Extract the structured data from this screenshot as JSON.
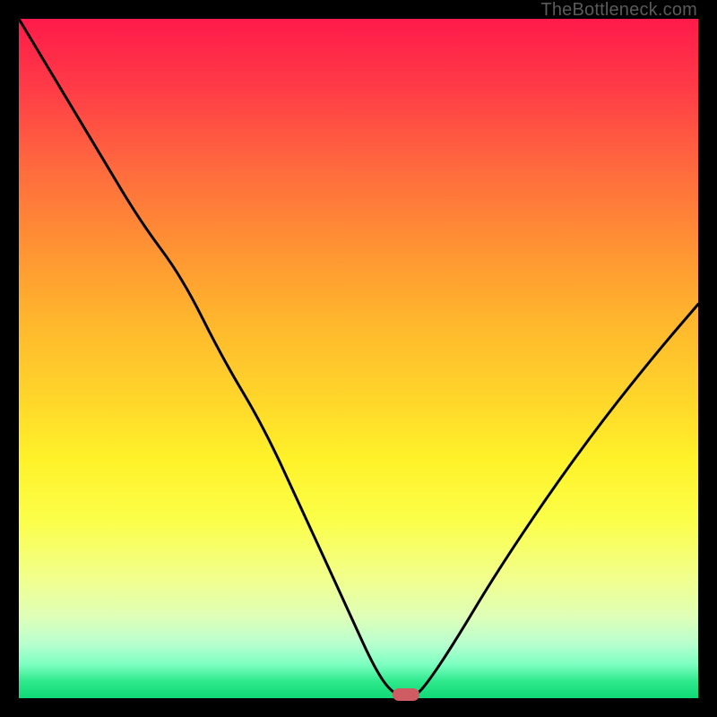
{
  "watermark": "TheBottleneck.com",
  "colors": {
    "frame": "#000000",
    "curve": "#000000",
    "marker": "#cf5b63",
    "gradient_top": "#ff1a4a",
    "gradient_bottom": "#0fd976"
  },
  "marker": {
    "x_pct": 57,
    "y_pct": 100
  },
  "chart_data": {
    "type": "line",
    "title": "",
    "xlabel": "",
    "ylabel": "",
    "xlim": [
      0,
      100
    ],
    "ylim": [
      0,
      100
    ],
    "grid": false,
    "legend": false,
    "series": [
      {
        "name": "bottleneck-curve",
        "x": [
          0,
          6,
          12,
          18,
          24,
          30,
          36,
          42,
          48,
          53,
          56,
          58,
          60,
          64,
          70,
          78,
          86,
          94,
          100
        ],
        "y": [
          100,
          90,
          80,
          70,
          62,
          50,
          40,
          27,
          14,
          3,
          0,
          0,
          2,
          8,
          18,
          30,
          41,
          51,
          58
        ]
      }
    ],
    "annotations": [
      {
        "type": "marker",
        "shape": "pill",
        "x": 57,
        "y": 0,
        "color": "#cf5b63"
      }
    ]
  }
}
